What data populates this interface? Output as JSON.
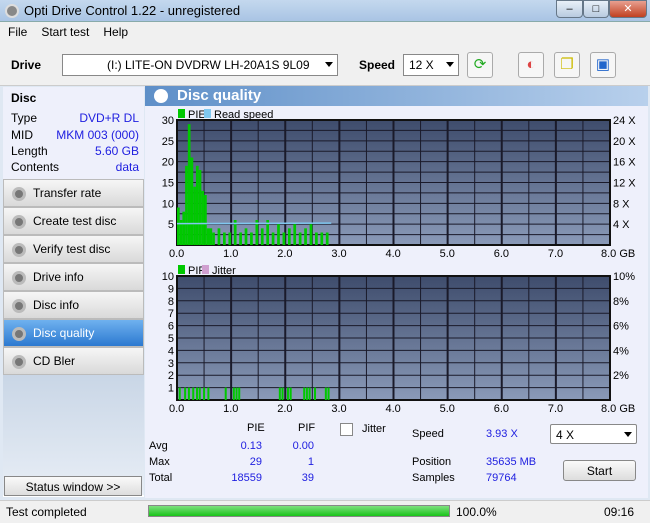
{
  "window": {
    "title": "Opti Drive Control 1.22 - unregistered"
  },
  "menu": [
    "File",
    "Start test",
    "Help"
  ],
  "toolbar": {
    "drive_label": "Drive",
    "drive_value": "(I:)  LITE-ON DVDRW LH-20A1S 9L09",
    "speed_label": "Speed",
    "speed_value": "12 X"
  },
  "disc": {
    "heading": "Disc",
    "rows": [
      {
        "k": "Type",
        "v": "DVD+R DL"
      },
      {
        "k": "MID",
        "v": "MKM 003 (000)"
      },
      {
        "k": "Length",
        "v": "5.60 GB"
      },
      {
        "k": "Contents",
        "v": "data"
      }
    ]
  },
  "nav": [
    "Transfer rate",
    "Create test disc",
    "Verify test disc",
    "Drive info",
    "Disc info",
    "Disc quality",
    "CD Bler"
  ],
  "nav_active": "Disc quality",
  "status_window": "Status window >>",
  "panel_title": "Disc quality",
  "chart_data": [
    {
      "type": "bar",
      "legend": [
        "PIE",
        "Read speed"
      ],
      "colors": {
        "PIE": "#00c800",
        "Read speed": "#80c8f0"
      },
      "x_ticks": [
        "0.0",
        "1.0",
        "2.0",
        "3.0",
        "4.0",
        "5.0",
        "6.0",
        "7.0",
        "8.0 GB"
      ],
      "xlim": [
        0,
        8
      ],
      "y_ticks": [
        "5",
        "10",
        "15",
        "20",
        "25",
        "30"
      ],
      "ylim": [
        0,
        30
      ],
      "y2_ticks": [
        "4 X",
        "8 X",
        "12 X",
        "16 X",
        "20 X",
        "24 X"
      ],
      "y2lim": [
        0,
        24
      ],
      "pie_x": [
        0.05,
        0.1,
        0.15,
        0.2,
        0.25,
        0.3,
        0.35,
        0.4,
        0.45,
        0.5,
        0.55,
        0.6,
        0.65,
        0.7,
        0.8,
        0.9,
        1.0,
        1.1,
        1.2,
        1.3,
        1.4,
        1.5,
        1.6,
        1.7,
        1.8,
        1.9,
        2.0,
        2.1,
        2.2,
        2.3,
        2.4,
        2.5,
        2.6,
        2.7,
        2.8
      ],
      "pie_y": [
        9,
        6,
        8,
        19,
        29,
        21,
        14,
        19,
        18,
        13,
        12,
        4,
        4,
        3,
        4,
        3,
        3,
        6,
        3,
        4,
        3,
        6,
        4,
        6,
        3,
        5,
        3,
        4,
        5,
        3,
        4,
        5,
        3,
        3,
        3
      ],
      "read_speed": {
        "x": [
          0,
          2.85
        ],
        "y": [
          4.1,
          4.2
        ]
      }
    },
    {
      "type": "bar",
      "legend": [
        "PIF",
        "Jitter"
      ],
      "colors": {
        "PIF": "#00c800",
        "Jitter": "#d0a0d0"
      },
      "x_ticks": [
        "0.0",
        "1.0",
        "2.0",
        "3.0",
        "4.0",
        "5.0",
        "6.0",
        "7.0",
        "8.0 GB"
      ],
      "xlim": [
        0,
        8
      ],
      "y_ticks": [
        "1",
        "2",
        "3",
        "4",
        "5",
        "6",
        "7",
        "8",
        "9",
        "10"
      ],
      "ylim": [
        0,
        10
      ],
      "y2_ticks": [
        "2%",
        "4%",
        "6%",
        "8%",
        "10%"
      ],
      "y2lim": [
        0,
        10
      ],
      "pif_x": [
        0.05,
        0.15,
        0.22,
        0.3,
        0.37,
        0.42,
        0.5,
        0.58,
        0.9,
        1.05,
        1.1,
        1.15,
        1.9,
        1.95,
        2.05,
        2.1,
        2.35,
        2.4,
        2.45,
        2.55,
        2.75,
        2.8
      ],
      "pif_y": [
        1,
        1,
        1,
        1,
        1,
        1,
        1,
        1,
        1,
        1,
        1,
        1,
        1,
        1,
        1,
        1,
        1,
        1,
        1,
        1,
        1,
        1
      ]
    }
  ],
  "stats": {
    "col_pie": "PIE",
    "col_pif": "PIF",
    "jitter_label": "Jitter",
    "rows": [
      {
        "k": "Avg",
        "pie": "0.13",
        "pif": "0.00"
      },
      {
        "k": "Max",
        "pie": "29",
        "pif": "1"
      },
      {
        "k": "Total",
        "pie": "18559",
        "pif": "39"
      }
    ],
    "speed_label": "Speed",
    "speed": "3.93 X",
    "position_label": "Position",
    "position": "35635 MB",
    "samples_label": "Samples",
    "samples": "79764",
    "speed_select": "4 X",
    "start": "Start"
  },
  "status": {
    "text": "Test completed",
    "progress_pct": 100,
    "progress_text": "100.0%",
    "time": "09:16"
  }
}
